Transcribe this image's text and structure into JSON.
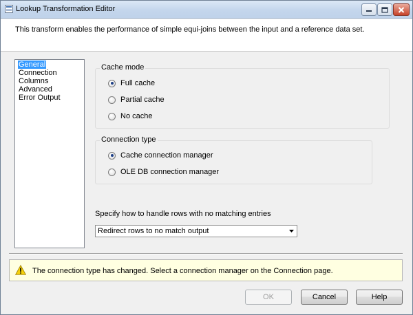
{
  "window": {
    "title": "Lookup Transformation Editor",
    "controls": {
      "minimize_icon": "minimize-icon",
      "maximize_icon": "maximize-icon",
      "close_icon": "close-icon"
    }
  },
  "header": {
    "description": "This transform enables the performance of simple equi-joins between the input and a reference data set."
  },
  "nav": {
    "items": [
      {
        "label": "General",
        "selected": true
      },
      {
        "label": "Connection",
        "selected": false
      },
      {
        "label": "Columns",
        "selected": false
      },
      {
        "label": "Advanced",
        "selected": false
      },
      {
        "label": "Error Output",
        "selected": false
      }
    ]
  },
  "cache_mode": {
    "title": "Cache mode",
    "options": [
      {
        "label": "Full cache",
        "checked": true
      },
      {
        "label": "Partial cache",
        "checked": false
      },
      {
        "label": "No cache",
        "checked": false
      }
    ]
  },
  "connection_type": {
    "title": "Connection type",
    "options": [
      {
        "label": "Cache connection manager",
        "checked": true
      },
      {
        "label": "OLE DB connection manager",
        "checked": false
      }
    ]
  },
  "no_match": {
    "label": "Specify how to handle rows with no matching entries",
    "selected": "Redirect rows to no match output"
  },
  "warning": {
    "icon": "warning-icon",
    "text": "The connection type has changed. Select a connection manager on the Connection page."
  },
  "buttons": {
    "ok": "OK",
    "cancel": "Cancel",
    "help": "Help"
  },
  "colors": {
    "selection": "#3399ff",
    "warning_background": "#ffffe1"
  }
}
